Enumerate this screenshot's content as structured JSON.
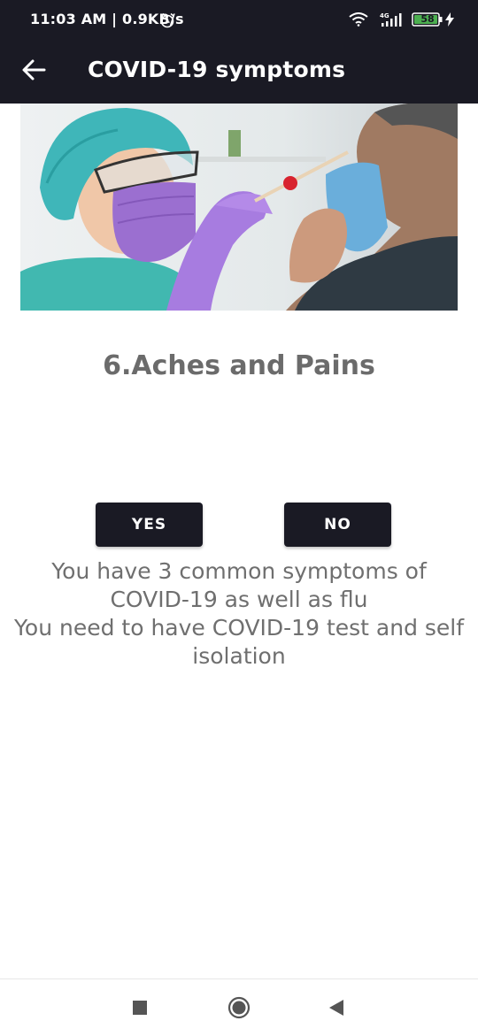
{
  "status_bar": {
    "time": "11:03 AM | 0.9KB/s",
    "network": "4G",
    "battery": "58",
    "icons": [
      "alarm-icon",
      "wifi-icon",
      "signal-icon",
      "battery-icon",
      "charging-bolt-icon"
    ]
  },
  "app_bar": {
    "title": "COVID-19 symptoms",
    "back_icon": "arrow-left-icon"
  },
  "content": {
    "symptom_title": "6.Aches and Pains",
    "yes_label": "YES",
    "no_label": "NO",
    "result_lines": [
      "You have 3 common symptoms of",
      "COVID-19 as well as flu",
      "You need to have COVID-19 test and self",
      "isolation"
    ]
  },
  "nav_bar": {
    "icons": [
      "recent-apps-icon",
      "home-icon",
      "back-triangle-icon"
    ]
  },
  "colors": {
    "app_bar": "#1a1a24",
    "button": "#1a1a24",
    "text_gray": "#6f6f6f"
  }
}
